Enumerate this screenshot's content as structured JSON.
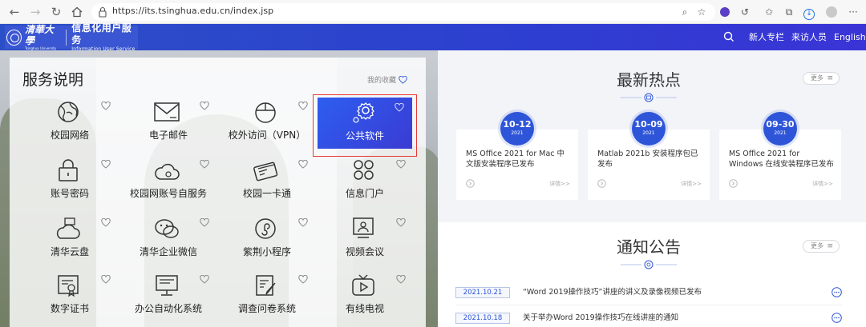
{
  "browser": {
    "url": "https://its.tsinghua.edu.cn/index.jsp"
  },
  "header": {
    "service_cn": "信息化用户服务",
    "service_en": "Information User Service",
    "nav": [
      "新人专栏",
      "来访人员",
      "English"
    ]
  },
  "services": {
    "title": "服务说明",
    "favorites": "我的收藏",
    "items": [
      {
        "label": "校园网络",
        "icon": "globe-icon"
      },
      {
        "label": "电子邮件",
        "icon": "envelope-icon"
      },
      {
        "label": "校外访问（VPN）",
        "icon": "vpn-icon"
      },
      {
        "label": "公共软件",
        "icon": "gear-icon",
        "active": true
      },
      {
        "label": "账号密码",
        "icon": "lock-icon"
      },
      {
        "label": "校园网账号自服务",
        "icon": "cloud-gear-icon"
      },
      {
        "label": "校园一卡通",
        "icon": "card-icon"
      },
      {
        "label": "信息门户",
        "icon": "grid-icon"
      },
      {
        "label": "清华云盘",
        "icon": "cloud-disk-icon"
      },
      {
        "label": "清华企业微信",
        "icon": "wechat-icon"
      },
      {
        "label": "紫荆小程序",
        "icon": "miniapp-icon"
      },
      {
        "label": "视频会议",
        "icon": "video-meeting-icon"
      },
      {
        "label": "数字证书",
        "icon": "certificate-icon"
      },
      {
        "label": "办公自动化系统",
        "icon": "monitor-icon"
      },
      {
        "label": "调查问卷系统",
        "icon": "survey-icon"
      },
      {
        "label": "有线电视",
        "icon": "tv-icon"
      }
    ]
  },
  "hot": {
    "title": "最新热点",
    "more": "更多",
    "items": [
      {
        "date": "10-12",
        "year": "2021",
        "title": "MS Office 2021 for Mac 中文版安装程序已发布",
        "detail": "详情>>"
      },
      {
        "date": "10-09",
        "year": "2021",
        "title": "Matlab 2021b 安装程序包已发布",
        "detail": "详情>>"
      },
      {
        "date": "09-30",
        "year": "2021",
        "title": "MS Office 2021 for Windows 在线安装程序已发布",
        "detail": "详情>>"
      }
    ]
  },
  "notice": {
    "title": "通知公告",
    "more": "更多",
    "items": [
      {
        "date": "2021.10.21",
        "text": "“Word 2019操作技巧”讲座的讲义及录像视频已发布"
      },
      {
        "date": "2021.10.18",
        "text": "关于举办Word 2019操作技巧在线讲座的通知"
      }
    ]
  },
  "colors": {
    "brand_blue": "#2e55d8",
    "highlight_red": "#e53935"
  }
}
